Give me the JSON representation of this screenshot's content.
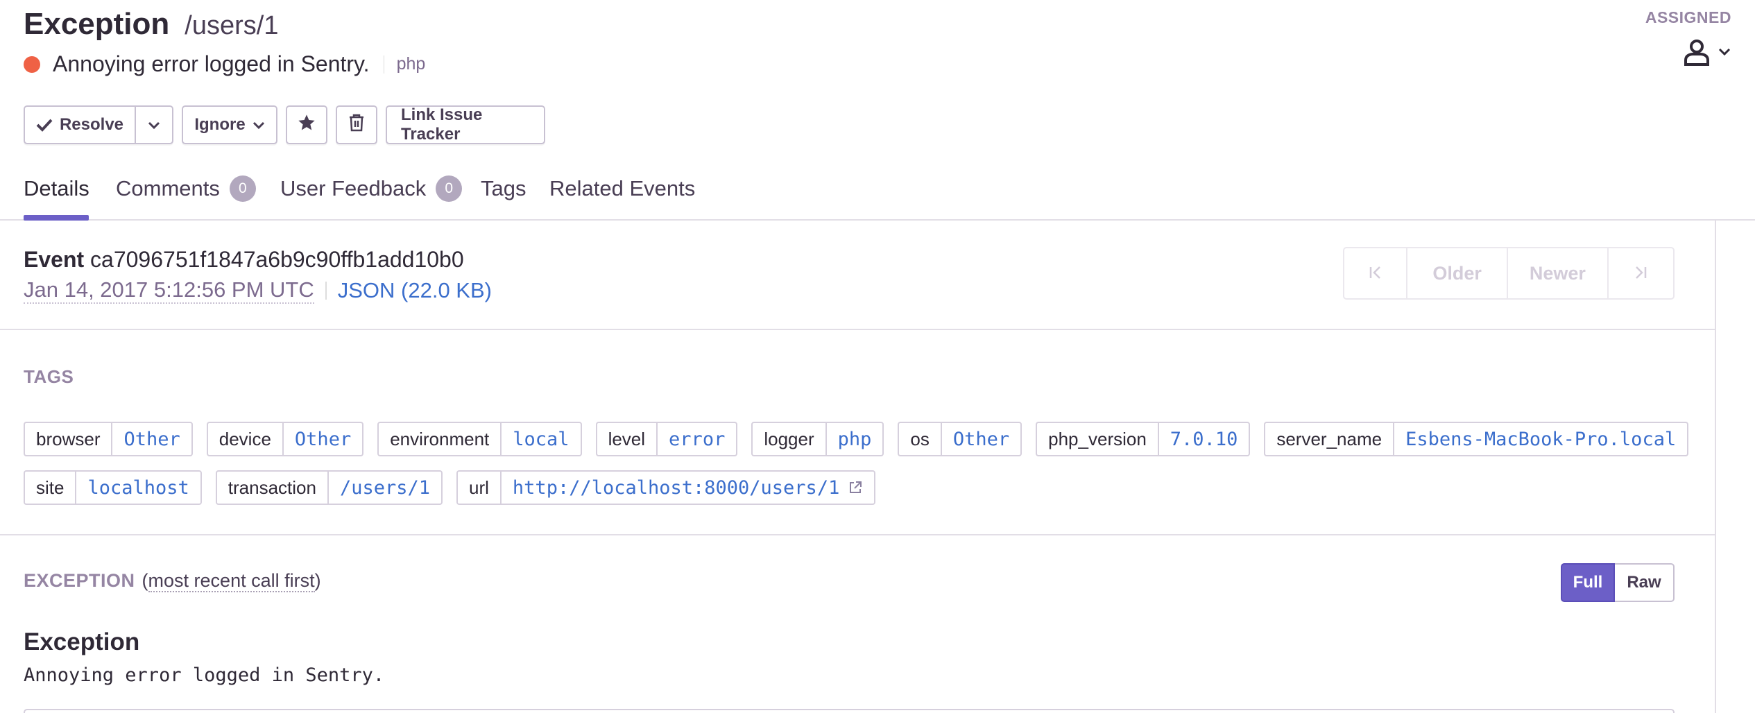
{
  "header": {
    "title": "Exception",
    "path": "/users/1",
    "message": "Annoying error logged in Sentry.",
    "platform": "php",
    "status_color": "#ef6145",
    "assigned_label": "ASSIGNED",
    "assignee_icon": "user-icon"
  },
  "actions": {
    "resolve": "Resolve",
    "ignore": "Ignore",
    "link_tracker": "Link Issue Tracker",
    "icons": [
      "check-icon",
      "chevron-down-icon",
      "star-icon",
      "trash-icon"
    ]
  },
  "tabs": [
    {
      "label": "Details"
    },
    {
      "label": "Comments",
      "count": "0"
    },
    {
      "label": "User Feedback",
      "count": "0"
    },
    {
      "label": "Tags"
    },
    {
      "label": "Related Events"
    }
  ],
  "event": {
    "label": "Event",
    "id": "ca7096751f1847a6b9c90ffb1add10b0",
    "date": "Jan 14, 2017 5:12:56 PM UTC",
    "json": "JSON (22.0 KB)"
  },
  "pager": {
    "first": "⇤",
    "older": "Older",
    "newer": "Newer",
    "last": "⇥"
  },
  "tags_title": "TAGS",
  "tags": [
    {
      "key": "browser",
      "value": "Other"
    },
    {
      "key": "device",
      "value": "Other"
    },
    {
      "key": "environment",
      "value": "local"
    },
    {
      "key": "level",
      "value": "error"
    },
    {
      "key": "logger",
      "value": "php"
    },
    {
      "key": "os",
      "value": "Other"
    },
    {
      "key": "php_version",
      "value": "7.0.10"
    },
    {
      "key": "server_name",
      "value": "Esbens-MacBook-Pro.local"
    },
    {
      "key": "site",
      "value": "localhost"
    },
    {
      "key": "transaction",
      "value": "/users/1"
    },
    {
      "key": "url",
      "value": "http://localhost:8000/users/1"
    }
  ],
  "exception": {
    "section_label": "EXCEPTION",
    "order_open": "(",
    "order_label": "most recent call first",
    "order_close": ")",
    "full": "Full",
    "raw": "Raw",
    "type": "Exception",
    "value": "Annoying error logged in Sentry."
  },
  "colors": {
    "accent": "#6c5fc7",
    "link": "#3b6ecc"
  }
}
